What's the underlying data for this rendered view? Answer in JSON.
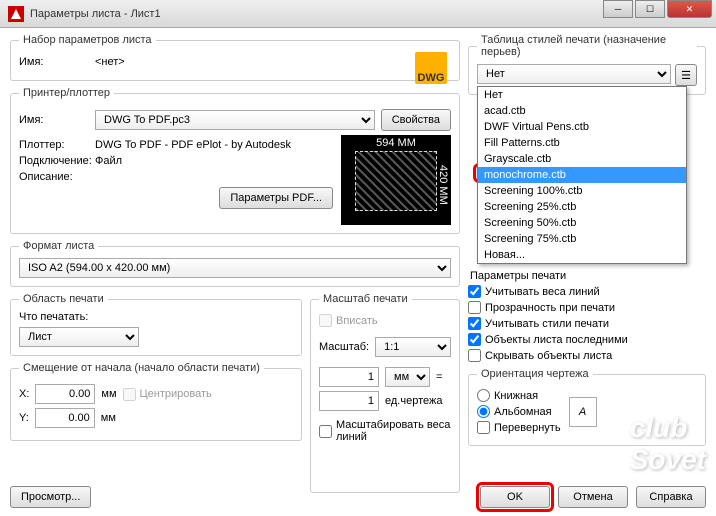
{
  "title": "Параметры листа - Лист1",
  "pageset": {
    "legend": "Набор параметров листа",
    "name_lbl": "Имя:",
    "name_val": "<нет>",
    "dwg": "DWG"
  },
  "printer": {
    "legend": "Принтер/плоттер",
    "name_lbl": "Имя:",
    "name_val": "DWG To PDF.pc3",
    "props_btn": "Свойства",
    "plotter_lbl": "Плоттер:",
    "plotter_val": "DWG To PDF - PDF ePlot - by Autodesk",
    "where_lbl": "Подключение:",
    "where_val": "Файл",
    "desc_lbl": "Описание:",
    "pdf_btn": "Параметры PDF...",
    "preview_w": "594 MM",
    "preview_h": "420 MM"
  },
  "paper": {
    "legend": "Формат листа",
    "val": "ISO A2 (594.00 x 420.00 мм)"
  },
  "area": {
    "legend": "Область печати",
    "what_lbl": "Что печатать:",
    "what_val": "Лист"
  },
  "offset": {
    "legend": "Смещение от начала (начало области печати)",
    "x_lbl": "X:",
    "x_val": "0.00",
    "y_lbl": "Y:",
    "y_val": "0.00",
    "unit": "мм",
    "center": "Центрировать"
  },
  "scale": {
    "legend": "Масштаб печати",
    "fit": "Вписать",
    "scale_lbl": "Масштаб:",
    "scale_val": "1:1",
    "num1": "1",
    "unit1": "мм",
    "eq": "=",
    "num2": "1",
    "unit2": "ед.чертежа",
    "lw": "Масштабировать веса линий"
  },
  "styles": {
    "legend": "Таблица стилей печати (назначение перьев)",
    "sel": "Нет",
    "opts": [
      "Нет",
      "acad.ctb",
      "DWF Virtual Pens.ctb",
      "Fill Patterns.ctb",
      "Grayscale.ctb",
      "monochrome.ctb",
      "Screening 100%.ctb",
      "Screening 25%.ctb",
      "Screening 50%.ctb",
      "Screening 75%.ctb",
      "Новая..."
    ],
    "sel_idx": 5
  },
  "shaded": {
    "legend": "Параметры печати"
  },
  "opts": {
    "lw": "Учитывать веса линий",
    "trans": "Прозрачность при печати",
    "styles": "Учитывать стили печати",
    "last": "Объекты листа последними",
    "hide": "Скрывать объекты листа"
  },
  "orient": {
    "legend": "Ориентация чертежа",
    "portrait": "Книжная",
    "landscape": "Альбомная",
    "upside": "Перевернуть",
    "A": "A"
  },
  "footer": {
    "preview": "Просмотр...",
    "ok": "OK",
    "cancel": "Отмена",
    "help": "Справка"
  }
}
